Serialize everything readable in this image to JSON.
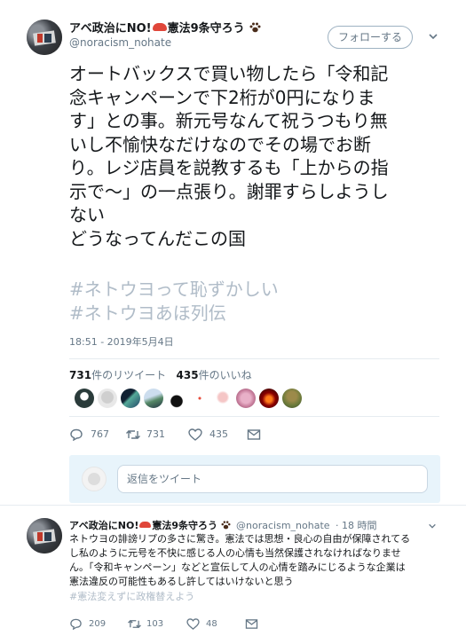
{
  "tweet": {
    "display_name": "アベ政治にNO!",
    "display_name_suffix": "憲法9条守ろう",
    "handle": "@noracism_nohate",
    "follow_label": "フォローする",
    "text_lines": [
      "オートバックスで買い物したら「令和記",
      "念キャンペーンで下2桁が0円になりま",
      "す」との事。新元号なんて祝うつもり無",
      "いし不愉快なだけなのでその場でお断",
      "り。レジ店員を説教するも「上からの指",
      "示で〜」の一点張り。謝罪すらしようし",
      "ない",
      "どうなってんだこの国"
    ],
    "hashtags": [
      "#ネトウヨって恥ずかしい",
      "#ネトウヨあほ列伝"
    ],
    "timestamp": "18:51 - 2019年5月4日",
    "retweet_count": "731",
    "retweet_label": "件のリツイート",
    "like_count": "435",
    "like_label": "件のいいね",
    "actions": {
      "reply": "767",
      "retweet": "731",
      "like": "435"
    },
    "reply_placeholder": "返信をツイート"
  },
  "reply": {
    "display_name": "アベ政治にNO!",
    "display_name_suffix": "憲法9条守ろう",
    "handle": "@noracism_nohate",
    "time": "· 18 時間",
    "text_lines": [
      "ネトウヨの誹謗リプの多さに驚き。憲法では思想・良心の自由が保障されてる",
      "し私のように元号を不快に感じる人の心情も当然保護されなければなりませ",
      "ん。「令和キャンペーン」などと宣伝して人の心情を踏みにじるような企業は",
      "憲法違反の可能性もあるし許してはいけないと思う"
    ],
    "hashtag": "#憲法変えずに政権替えよう",
    "actions": {
      "reply": "209",
      "retweet": "103",
      "like": "48"
    }
  },
  "colors": {
    "accent": "#1da1f2",
    "muted": "#657786",
    "hashtag": "#b0bcc8",
    "reply_bg": "#e8f4fb"
  },
  "icons": [
    "chevron-down-icon",
    "reply-icon",
    "retweet-icon",
    "heart-icon",
    "message-icon",
    "paw-emoji",
    "shrimp-emoji"
  ]
}
